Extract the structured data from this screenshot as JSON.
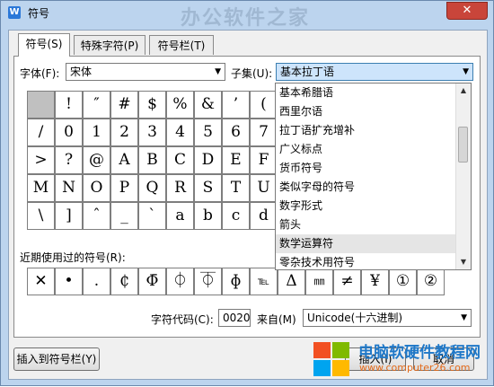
{
  "window": {
    "title": "符号",
    "watermark": "办公软件之家",
    "close": "✕"
  },
  "tabs": [
    {
      "label": "符号(S)"
    },
    {
      "label": "特殊字符(P)"
    },
    {
      "label": "符号栏(T)"
    }
  ],
  "font": {
    "label": "字体(F):",
    "value": "宋体"
  },
  "subset": {
    "label": "子集(U):",
    "value": "基本拉丁语"
  },
  "grid": [
    [
      "",
      "!",
      "″",
      "#",
      "$",
      "%",
      "&",
      "’",
      "("
    ],
    [
      "/",
      "0",
      "1",
      "2",
      "3",
      "4",
      "5",
      "6",
      "7"
    ],
    [
      ">",
      "?",
      "@",
      "A",
      "B",
      "C",
      "D",
      "E",
      "F"
    ],
    [
      "M",
      "N",
      "O",
      "P",
      "Q",
      "R",
      "S",
      "T",
      "U"
    ],
    [
      "\\",
      "]",
      "ˆ",
      "_",
      "`",
      "a",
      "b",
      "c",
      "d"
    ]
  ],
  "dropdown_items": [
    "基本希腊语",
    "西里尔语",
    "拉丁语扩充增补",
    "广义标点",
    "货币符号",
    "类似字母的符号",
    "数字形式",
    "箭头",
    "数学运算符",
    "零杂技术用符号"
  ],
  "recent": {
    "label": "近期使用过的符号(R):",
    "symbols": [
      "✕",
      "•",
      ".",
      "₵",
      "Φ̄",
      "⏀",
      "⏁",
      "ɸ",
      "℡",
      "Δ",
      "㎜",
      "≠",
      "¥",
      "①",
      "②"
    ]
  },
  "char_code": {
    "label": "字符代码(C):",
    "value": "0020"
  },
  "from": {
    "label": "来自(M)",
    "value": "Unicode(十六进制)"
  },
  "buttons": {
    "insert_to_bar": "插入到符号栏(Y)",
    "insert": "插入(I)",
    "cancel": "取消"
  },
  "brand": {
    "name": "电脑软硬件教程网",
    "url": "www.computer26.com"
  },
  "colors": {
    "title_bg": "#bcd4ee",
    "selected_item": "#e5e5e5",
    "accent": "#1f78c8"
  }
}
